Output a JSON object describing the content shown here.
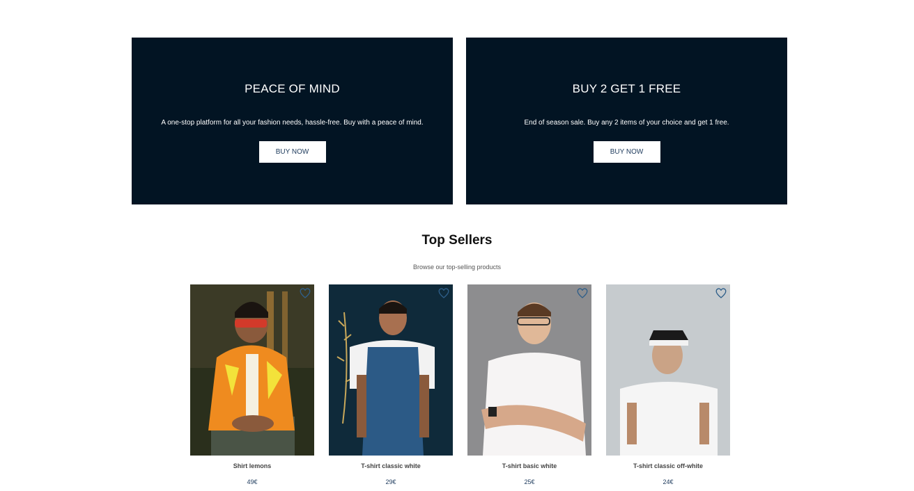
{
  "promos": [
    {
      "title": "PEACE OF MIND",
      "text": "A one-stop platform for all your fashion needs, hassle-free. Buy with a peace of mind.",
      "button": "BUY NOW"
    },
    {
      "title": "BUY 2 GET 1 FREE",
      "text": "End of season sale. Buy any 2 items of your choice and get 1 free.",
      "button": "BUY NOW"
    }
  ],
  "top_sellers": {
    "title": "Top Sellers",
    "subtitle": "Browse our top-selling products",
    "products": [
      {
        "name": "Shirt lemons",
        "price": "49€"
      },
      {
        "name": "T-shirt classic white",
        "price": "29€"
      },
      {
        "name": "T-shirt basic white",
        "price": "25€"
      },
      {
        "name": "T-shirt classic off-white",
        "price": "24€"
      }
    ]
  },
  "colors": {
    "banner_bg": "#021423",
    "accent": "#1d3a5c",
    "heart": "#2f5f8a"
  }
}
